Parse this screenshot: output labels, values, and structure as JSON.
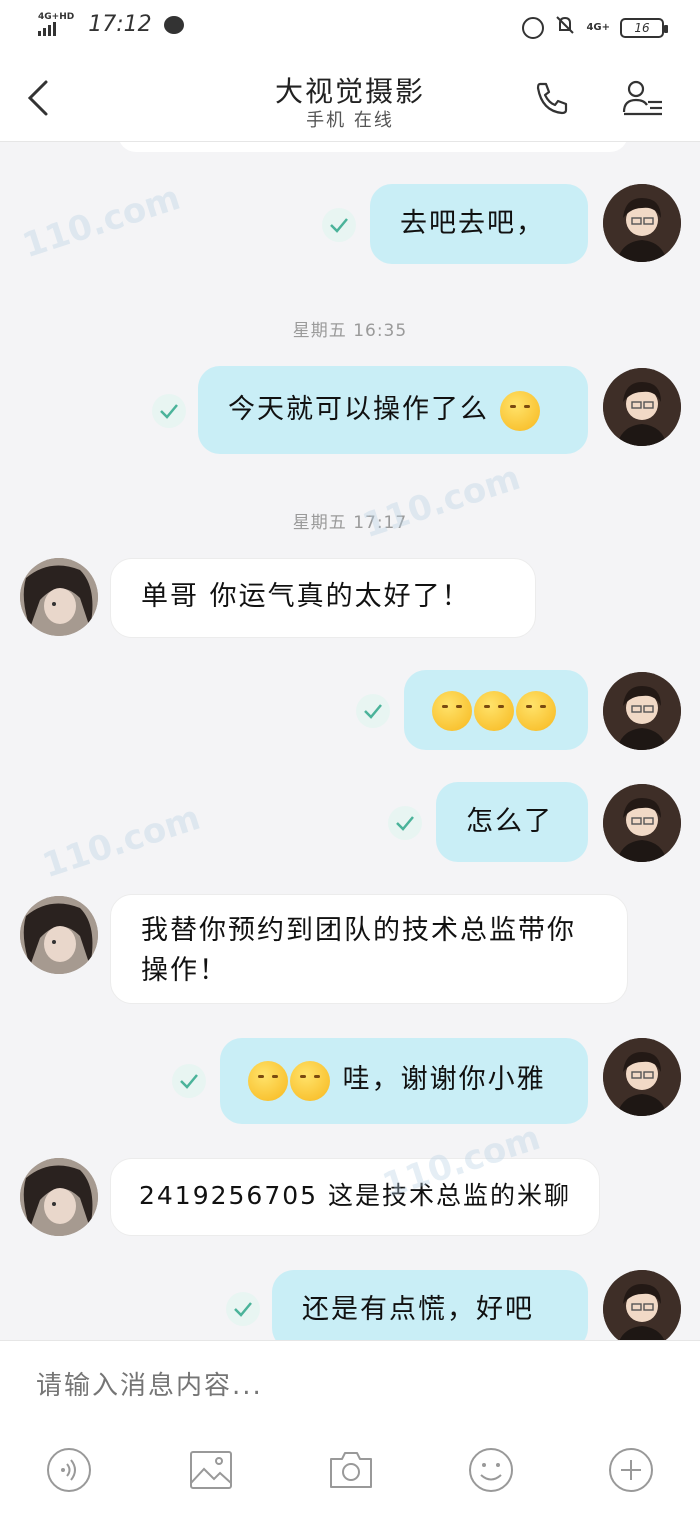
{
  "status_bar": {
    "network_left": "4G+HD",
    "time": "17:12",
    "network_right": "4G+",
    "battery": "16"
  },
  "header": {
    "title": "大视觉摄影",
    "subtitle": "手机 在线"
  },
  "messages": [
    {
      "text": "去吧去吧，"
    },
    {
      "timestamp": "星期五 16:35"
    },
    {
      "text": "今天就可以操作了么"
    },
    {
      "timestamp": "星期五 17:17"
    },
    {
      "text": "单哥 你运气真的太好了！"
    },
    {
      "text": ""
    },
    {
      "text": "怎么了"
    },
    {
      "text": "我替你预约到团队的技术总监带你操作！"
    },
    {
      "text": "哇，谢谢你小雅"
    },
    {
      "text": "2419256705 这是技术总监的米聊"
    },
    {
      "text": "还是有点慌，好吧"
    }
  ],
  "input": {
    "placeholder": "请输入消息内容..."
  },
  "toolbar": {
    "icons": [
      "voice-icon",
      "image-icon",
      "camera-icon",
      "emoji-icon",
      "plus-icon"
    ]
  },
  "watermark": "110.com"
}
